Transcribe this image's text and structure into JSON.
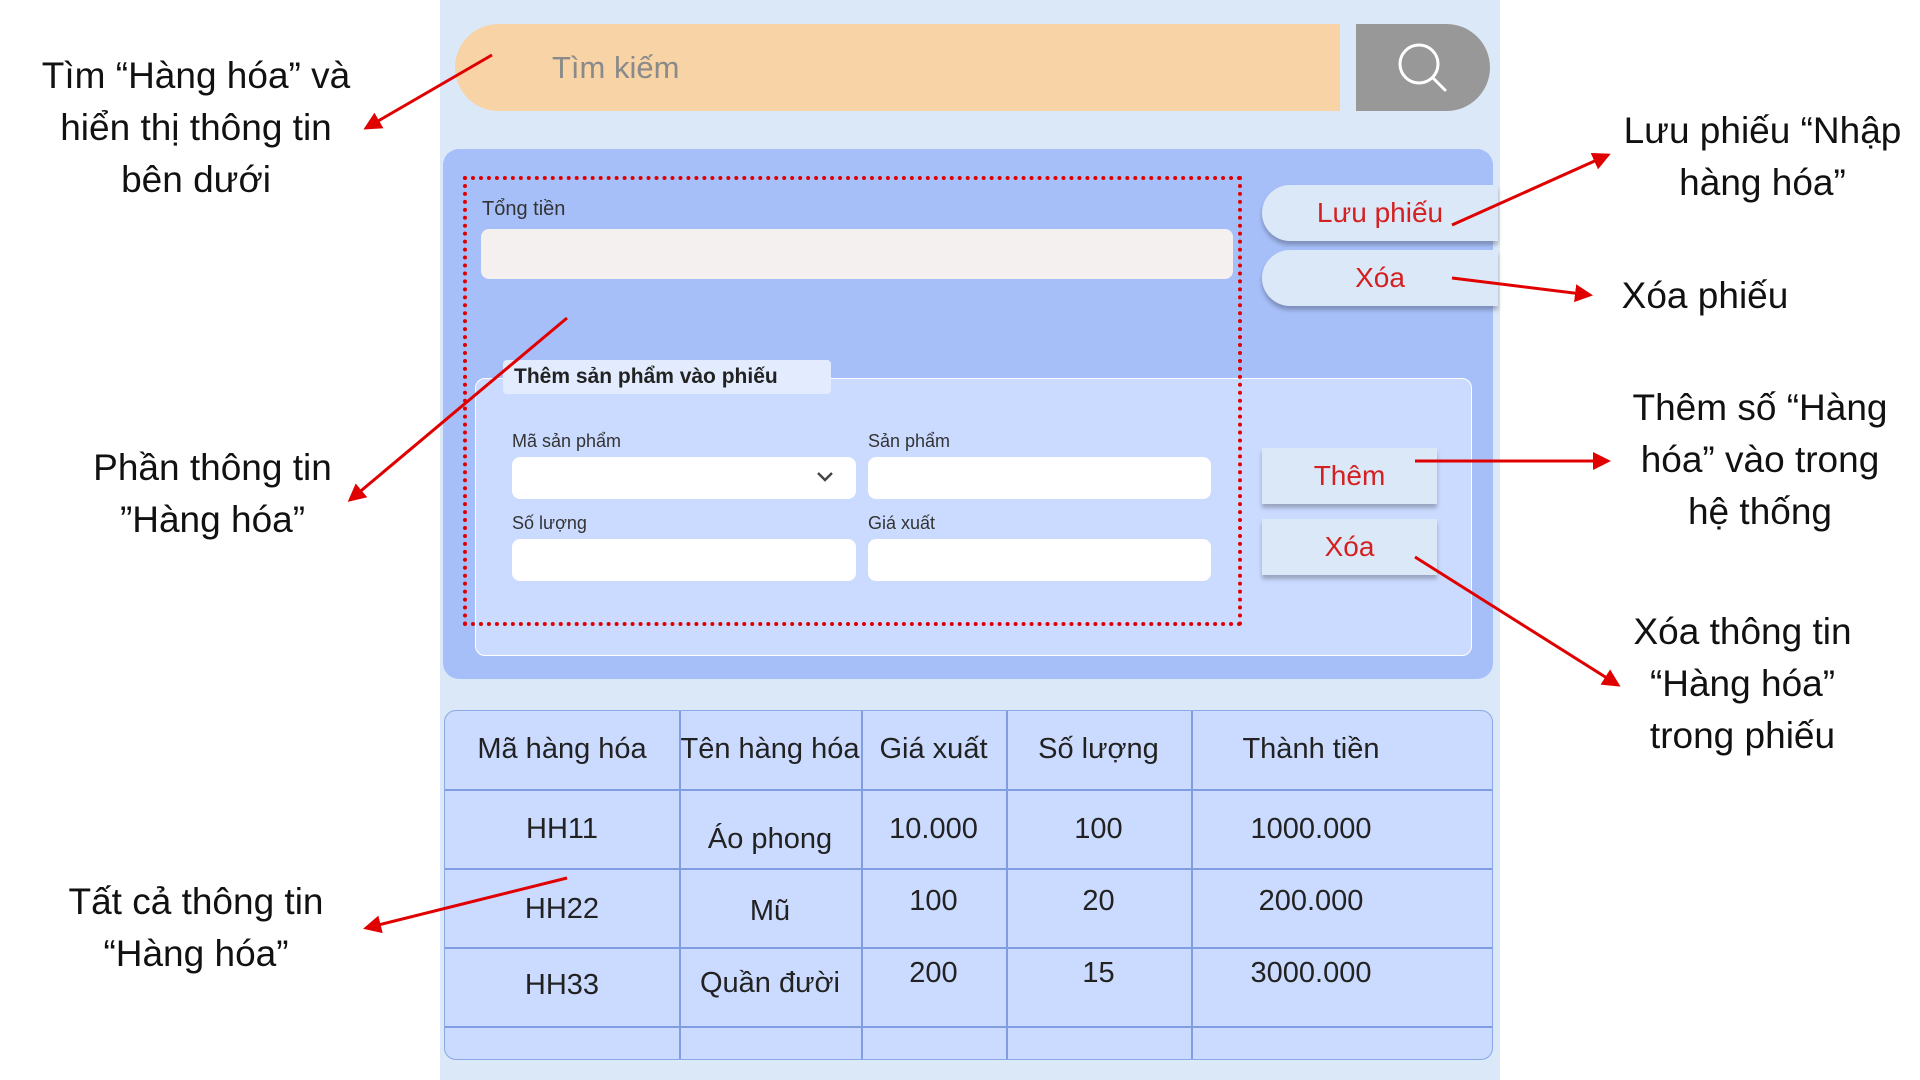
{
  "search": {
    "placeholder": "Tìm kiếm",
    "icon": "search-icon"
  },
  "receipt": {
    "total_label": "Tổng tiền",
    "total_value": "",
    "save_button": "Lưu phiếu",
    "delete_button": "Xóa"
  },
  "add_section": {
    "title": "Thêm sản phẩm vào phiếu",
    "product_code_label": "Mã sản phẩm",
    "product_name_label": "Sản phẩm",
    "quantity_label": "Số lượng",
    "price_label": "Giá xuất",
    "add_button": "Thêm",
    "delete_button": "Xóa"
  },
  "table": {
    "headers": [
      "Mã hàng hóa",
      "Tên hàng hóa",
      "Giá xuất",
      "Số lượng",
      "Thành tiền"
    ],
    "rows": [
      [
        "HH11",
        "Áo phong",
        "10.000",
        "100",
        "1000.000"
      ],
      [
        "HH22",
        "Mũ",
        "100",
        "20",
        "200.000"
      ],
      [
        "HH33",
        "Quần đười",
        "200",
        "15",
        "3000.000"
      ]
    ]
  },
  "annotations": {
    "search_note": [
      "Tìm “Hàng hóa” và",
      "hiển thị thông tin",
      "bên dưới"
    ],
    "info_note": [
      "Phần thông tin",
      "”Hàng hóa”"
    ],
    "table_note": [
      "Tất cả thông tin",
      "“Hàng hóa”"
    ],
    "save_note": [
      "Lưu phiếu “Nhập",
      "hàng hóa”"
    ],
    "delete_receipt_note": [
      "Xóa phiếu"
    ],
    "add_note": [
      "Thêm số “Hàng",
      "hóa” vào trong",
      "hệ thống"
    ],
    "delete_item_note": [
      "Xóa thông tin",
      "“Hàng hóa”",
      "trong phiếu"
    ]
  },
  "colors": {
    "accent_red": "#d42020",
    "panel_blue": "#a7bff9",
    "search_orange": "#f7d3a6",
    "annotation_red": "#e00000"
  }
}
